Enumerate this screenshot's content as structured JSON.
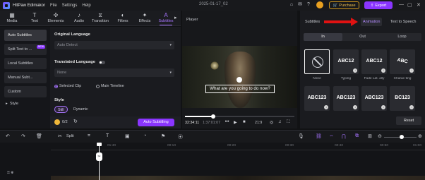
{
  "titlebar": {
    "app_name": "HitPaw Edimakor",
    "menu": [
      "File",
      "Settings",
      "Help"
    ],
    "project_name": "2025-01-17_02",
    "purchase_label": "Purchase",
    "export_label": "Export"
  },
  "toolbar": {
    "tools": [
      {
        "label": "Media",
        "icon": "media-icon"
      },
      {
        "label": "Text",
        "icon": "text-icon"
      },
      {
        "label": "Elements",
        "icon": "elements-icon"
      },
      {
        "label": "Audio",
        "icon": "audio-icon"
      },
      {
        "label": "Transition",
        "icon": "transition-icon"
      },
      {
        "label": "Filters",
        "icon": "filters-icon"
      },
      {
        "label": "Effects",
        "icon": "effects-icon"
      },
      {
        "label": "Subtitles",
        "icon": "subtitles-icon"
      }
    ]
  },
  "leftnav": {
    "items": [
      "Auto Subtitles",
      "Split Text to ...",
      "Local Subtitles",
      "Manual Subt...",
      "Custom"
    ],
    "new_badge": "NEW",
    "style_label": "Style"
  },
  "settings": {
    "original_language_title": "Original Language",
    "original_language_value": "Auto Detect",
    "translated_language_title": "Translated Language",
    "translated_language_value": "None",
    "radio_selected_clip": "Selected Clip",
    "radio_main_timeline": "Main Timeline",
    "style_title": "Style",
    "style_tabs": [
      "Still",
      "Dynamic"
    ],
    "credits": "0/2",
    "auto_button": "Auto Subtitling"
  },
  "player": {
    "title": "Player",
    "caption": "What are you going to do now?",
    "progress": 0.26,
    "time_current": "32:34:11",
    "time_total": "1:37:01:07",
    "ratio": "21:9"
  },
  "rpanel": {
    "tabs": [
      "Subtitles",
      "Animation",
      "Text to Speech"
    ],
    "segments": [
      "In",
      "Out",
      "Loop"
    ],
    "cards": [
      {
        "sample": "",
        "label": "None"
      },
      {
        "sample": "ABC12",
        "label": "Typing"
      },
      {
        "sample": "ABC12",
        "label": "Fade Lat. ally"
      },
      {
        "sample": "ABC",
        "label": "Charac-ting"
      },
      {
        "sample": "ABC123",
        "label": ""
      },
      {
        "sample": "ABC123",
        "label": ""
      },
      {
        "sample": "ABC123",
        "label": ""
      },
      {
        "sample": "BC123",
        "label": ""
      }
    ],
    "reset_label": "Reset"
  },
  "timeline": {
    "split_label": "Split",
    "ruler": [
      "01:40",
      "00:10",
      "00:20",
      "00:30",
      "00:40",
      "00:50",
      "01:00"
    ]
  },
  "colors": {
    "accent": "#8a35ff",
    "accent_text": "#a774ff",
    "arrow": "#e01212",
    "purchase": "#f3c24d"
  }
}
